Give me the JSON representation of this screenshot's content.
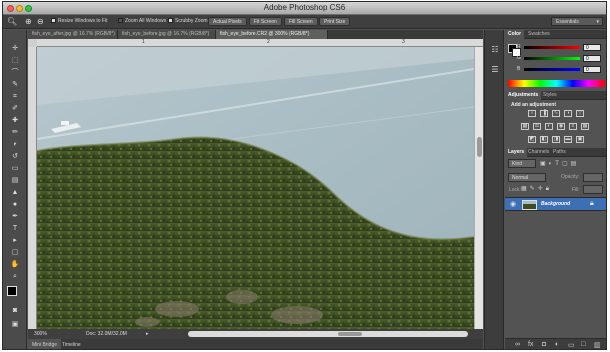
{
  "app": {
    "title": "Adobe Photoshop CS6"
  },
  "options": {
    "resize_windows": "Resize Windows to Fit",
    "zoom_all": "Zoom All Windows",
    "scrubby_zoom": "Scrubby Zoom",
    "actual_pixels": "Actual Pixels",
    "fit_screen": "Fit Screen",
    "fill_screen": "Fill Screen",
    "print_size": "Print Size",
    "workspace": "Essentials"
  },
  "doc_tabs": [
    {
      "label": "fish_eye_after.jpg @ 16.7% (RGB/8*)"
    },
    {
      "label": "fish_eye_before.jpg @ 16.7% (RGB/8*)"
    },
    {
      "label": "fish_eye_before.CR2 @ 300% (RGB/8*)"
    }
  ],
  "ruler": {
    "ticks": [
      "1",
      "2",
      "3"
    ]
  },
  "status": {
    "zoom": "300%",
    "doc": "Doc: 32.0M/32.0M"
  },
  "bottom_tabs": [
    "Mini Bridge",
    "Timeline"
  ],
  "color_panel": {
    "tabs": [
      "Color",
      "Swatches"
    ],
    "channels": [
      {
        "label": "R",
        "value": "0"
      },
      {
        "label": "G",
        "value": "0"
      },
      {
        "label": "B",
        "value": "0"
      }
    ]
  },
  "adjustments_panel": {
    "tabs": [
      "Adjustments",
      "Styles"
    ],
    "heading": "Add an adjustment"
  },
  "layers_panel": {
    "tabs": [
      "Layers",
      "Channels",
      "Paths"
    ],
    "kind": "Kind",
    "blend_mode": "Normal",
    "opacity_label": "Opacity:",
    "lock_label": "Lock:",
    "fill_label": "Fill:",
    "layers": [
      {
        "name": "Background"
      }
    ]
  },
  "colors": {
    "accent": "#3d6fb5",
    "panel": "#535353",
    "dark": "#3a3a3a"
  }
}
